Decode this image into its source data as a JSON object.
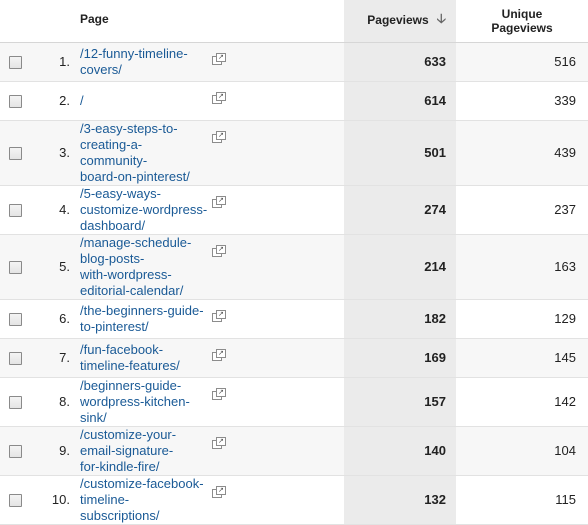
{
  "table": {
    "headers": {
      "page": "Page",
      "pageviews": "Pageviews",
      "sort_icon": "down-arrow-icon",
      "unique_line1": "Unique",
      "unique_line2": "Pageviews"
    },
    "rows": [
      {
        "index": "1.",
        "page_line1": "/12-funny-timeline-covers/",
        "page_line2": "",
        "pageviews": "633",
        "unique": "516"
      },
      {
        "index": "2.",
        "page_line1": "/",
        "page_line2": "",
        "pageviews": "614",
        "unique": "339"
      },
      {
        "index": "3.",
        "page_line1": "/3-easy-steps-to-creating-a-community-",
        "page_line2": "board-on-pinterest/",
        "pageviews": "501",
        "unique": "439"
      },
      {
        "index": "4.",
        "page_line1": "/5-easy-ways-customize-wordpress-",
        "page_line2": "dashboard/",
        "pageviews": "274",
        "unique": "237"
      },
      {
        "index": "5.",
        "page_line1": "/manage-schedule-blog-posts-",
        "page_line2": "with-wordpress-editorial-calendar/",
        "pageviews": "214",
        "unique": "163"
      },
      {
        "index": "6.",
        "page_line1": "/the-beginners-guide-to-pinterest/",
        "page_line2": "",
        "pageviews": "182",
        "unique": "129"
      },
      {
        "index": "7.",
        "page_line1": "/fun-facebook-timeline-features/",
        "page_line2": "",
        "pageviews": "169",
        "unique": "145"
      },
      {
        "index": "8.",
        "page_line1": "/beginners-guide-wordpress-kitchen-sink/",
        "page_line2": "",
        "pageviews": "157",
        "unique": "142"
      },
      {
        "index": "9.",
        "page_line1": "/customize-your-email-signature-",
        "page_line2": "for-kindle-fire/",
        "pageviews": "140",
        "unique": "104"
      },
      {
        "index": "10.",
        "page_line1": "/customize-facebook-timeline-subscriptions/",
        "page_line2": "",
        "pageviews": "132",
        "unique": "115"
      }
    ]
  },
  "colors": {
    "link": "#1a5a96",
    "pageviews_column_bg": "#ebebeb",
    "stripe_bg": "#f7f7f7"
  }
}
